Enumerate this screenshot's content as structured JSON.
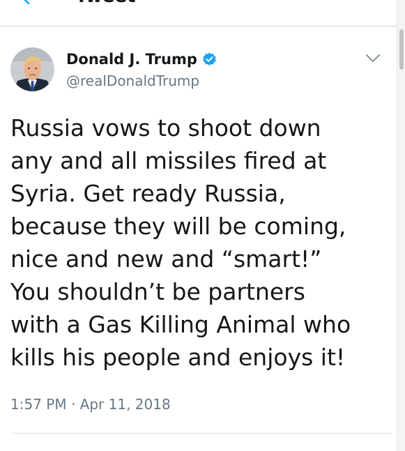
{
  "nav": {
    "title": "Tweet",
    "back_icon": "chevron-left-icon"
  },
  "tweet": {
    "display_name": "Donald J. Trump",
    "verified": true,
    "handle": "@realDonaldTrump",
    "text": "Russia vows to shoot down\nany and all missiles fired at\nSyria. Get ready Russia,\nbecause they will be coming,\nnice and new and “smart!”\nYou shouldn’t be partners\nwith a Gas Killing Animal who\nkills his people and enjoys it!",
    "time": "1:57 PM",
    "separator": "·",
    "date": "Apr 11, 2018"
  },
  "icons": {
    "avatar": "avatar-photo",
    "verified": "verified-badge-icon",
    "menu": "chevron-down-icon"
  },
  "colors": {
    "text_primary": "#14171a",
    "text_secondary": "#657786",
    "accent": "#1da1f2",
    "divider": "#e1e8ed"
  }
}
